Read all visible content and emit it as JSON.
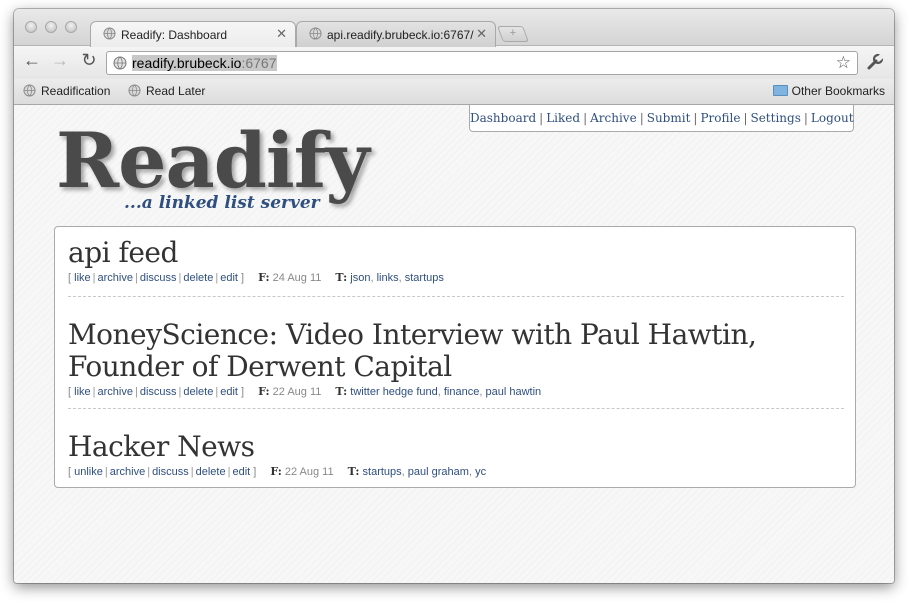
{
  "browser": {
    "tabs": [
      {
        "title": "Readify: Dashboard",
        "close": "✕"
      },
      {
        "title": "api.readify.brubeck.io:6767/",
        "close": "✕"
      }
    ],
    "newtab_label": "+",
    "url_host": "readify.brubeck.io",
    "url_port": ":6767",
    "bookmarks": [
      {
        "label": "Readification"
      },
      {
        "label": "Read Later"
      }
    ],
    "other_bookmarks": "Other Bookmarks"
  },
  "site": {
    "nav": [
      "Dashboard",
      "Liked",
      "Archive",
      "Submit",
      "Profile",
      "Settings",
      "Logout"
    ],
    "nav_separator": "|",
    "logo": "Readify",
    "tagline": "...a linked list server"
  },
  "items": [
    {
      "title": "api feed",
      "actions": [
        "like",
        "archive",
        "discuss",
        "delete",
        "edit"
      ],
      "f_label": "F:",
      "date": "24 Aug 11",
      "t_label": "T:",
      "tags": [
        "json",
        "links",
        "startups"
      ]
    },
    {
      "title": "MoneyScience: Video Interview with Paul Hawtin, Founder of Derwent Capital",
      "actions": [
        "like",
        "archive",
        "discuss",
        "delete",
        "edit"
      ],
      "f_label": "F:",
      "date": "22 Aug 11",
      "t_label": "T:",
      "tags": [
        "twitter hedge fund",
        "finance",
        "paul hawtin"
      ]
    },
    {
      "title": "Hacker News",
      "actions": [
        "unlike",
        "archive",
        "discuss",
        "delete",
        "edit"
      ],
      "f_label": "F:",
      "date": "22 Aug 11",
      "t_label": "T:",
      "tags": [
        "startups",
        "paul graham",
        "yc"
      ]
    }
  ],
  "icons": {
    "back": "back-arrow-icon",
    "forward": "forward-arrow-icon",
    "reload": "reload-icon",
    "star": "bookmark-star-icon",
    "wrench": "wrench-icon",
    "globe": "globe-icon",
    "folder": "folder-icon"
  },
  "colors": {
    "link": "#2f4f7f",
    "logo": "#4a4a4a",
    "title": "#333333"
  }
}
